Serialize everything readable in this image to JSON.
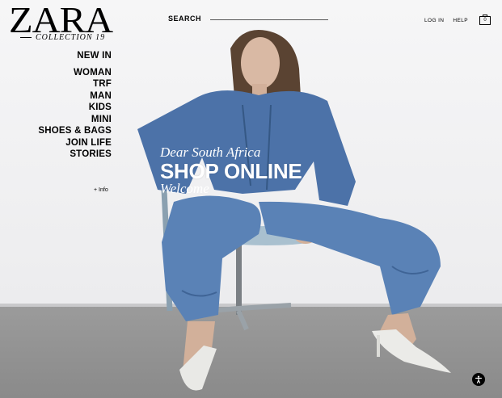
{
  "brand": {
    "logo_text": "ZARA",
    "collection_text": "COLLECTION 19"
  },
  "header": {
    "search_label": "SEARCH",
    "login_label": "LOG IN",
    "help_label": "HELP",
    "cart_count": "0"
  },
  "nav": {
    "items": [
      {
        "label": "NEW IN"
      },
      {
        "label": "WOMAN"
      },
      {
        "label": "TRF"
      },
      {
        "label": "MAN"
      },
      {
        "label": "KIDS"
      },
      {
        "label": "MINI"
      },
      {
        "label": "SHOES & BAGS"
      },
      {
        "label": "JOIN LIFE"
      },
      {
        "label": "STORIES"
      }
    ],
    "info_label": "+ Info"
  },
  "promo": {
    "line1": "Dear South Africa",
    "main": "SHOP ONLINE",
    "line2": "Welcome"
  },
  "icons": {
    "cart": "shopping-bag-icon",
    "accessibility": "accessibility-icon"
  }
}
